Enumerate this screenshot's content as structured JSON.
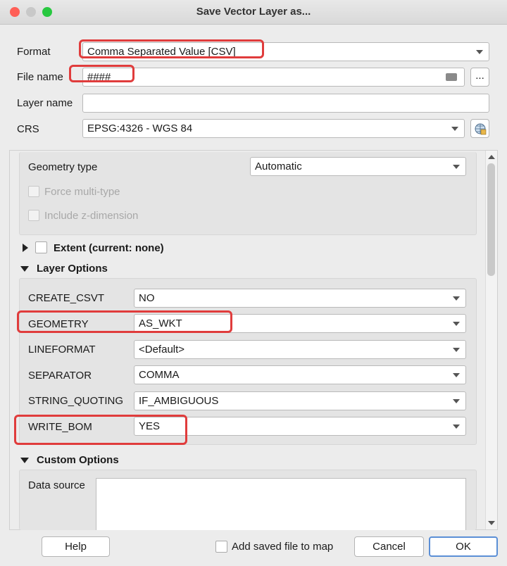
{
  "window": {
    "title": "Save Vector Layer as..."
  },
  "form": {
    "format_label": "Format",
    "format_value": "Comma Separated Value [CSV]",
    "filename_label": "File name",
    "filename_value": "####",
    "browse_label": "...",
    "layername_label": "Layer name",
    "layername_value": "",
    "crs_label": "CRS",
    "crs_value": "EPSG:4326 - WGS 84"
  },
  "geometry": {
    "type_label": "Geometry type",
    "type_value": "Automatic",
    "force_multi_label": "Force multi-type",
    "include_z_label": "Include z-dimension"
  },
  "extent": {
    "label": "Extent (current: none)"
  },
  "layer_options": {
    "heading": "Layer Options",
    "rows": [
      {
        "key": "CREATE_CSVT",
        "value": "NO"
      },
      {
        "key": "GEOMETRY",
        "value": "AS_WKT"
      },
      {
        "key": "LINEFORMAT",
        "value": "<Default>"
      },
      {
        "key": "SEPARATOR",
        "value": "COMMA"
      },
      {
        "key": "STRING_QUOTING",
        "value": "IF_AMBIGUOUS"
      },
      {
        "key": "WRITE_BOM",
        "value": "YES"
      }
    ]
  },
  "custom_options": {
    "heading": "Custom Options",
    "data_source_label": "Data source",
    "data_source_value": ""
  },
  "footer": {
    "help_label": "Help",
    "add_saved_label": "Add saved file to map",
    "cancel_label": "Cancel",
    "ok_label": "OK"
  },
  "colors": {
    "highlight": "#e03c3c",
    "ok_border": "#5b8fd6"
  }
}
